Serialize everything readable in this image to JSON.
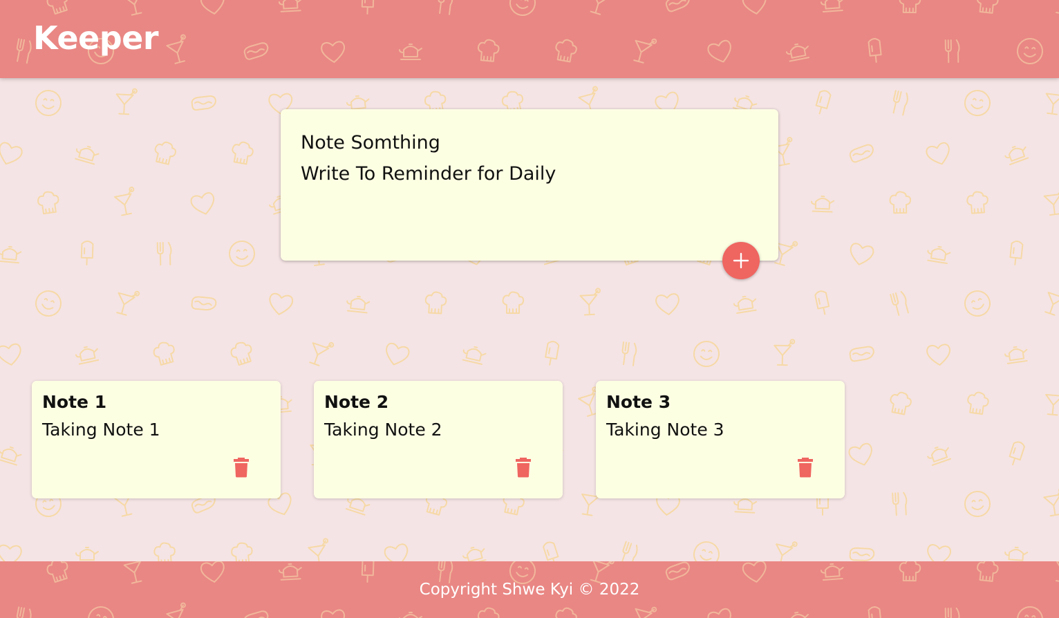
{
  "header": {
    "title": "Keeper"
  },
  "create_area": {
    "title_value": "Note Somthing",
    "content_value": "Write To Reminder for Daily",
    "add_icon": "plus-icon"
  },
  "notes": [
    {
      "title": "Note 1",
      "content": "Taking Note 1",
      "delete_icon": "trash-icon"
    },
    {
      "title": "Note 2",
      "content": "Taking Note 2",
      "delete_icon": "trash-icon"
    },
    {
      "title": "Note 3",
      "content": "Taking Note 3",
      "delete_icon": "trash-icon"
    }
  ],
  "footer": {
    "copyright": "Copyright Shwe Kyi © 2022"
  },
  "colors": {
    "bar": "#e98784",
    "background": "#f5e4e5",
    "note": "#fdffe3",
    "accent": "#ef6560",
    "pattern": "#f6d9a6"
  }
}
